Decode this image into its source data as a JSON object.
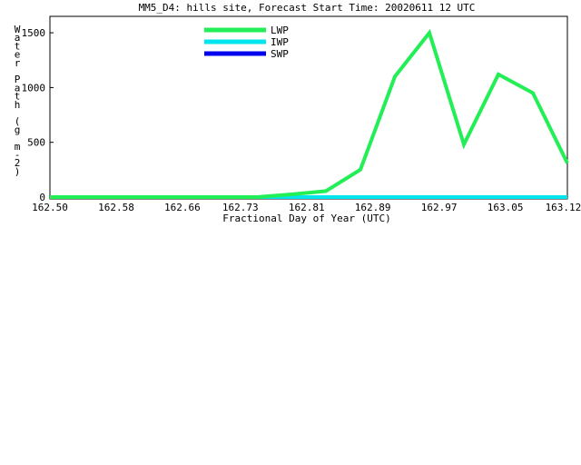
{
  "chart_data": {
    "type": "line",
    "title": "MM5_D4: hills site,  Forecast Start Time: 20020611 12 UTC",
    "xlabel": "Fractional Day of Year (UTC)",
    "ylabel": "Water Path (g m-2)",
    "ylabel_chars": [
      "W",
      "a",
      "t",
      "e",
      "r",
      "",
      "P",
      "a",
      "t",
      "h",
      "",
      "(",
      "g",
      "",
      "m",
      "-",
      "2",
      ")"
    ],
    "xlim": [
      162.5,
      163.125
    ],
    "ylim": [
      0,
      1650
    ],
    "x_ticks": [
      162.5,
      162.58,
      162.66,
      162.73,
      162.81,
      162.89,
      162.97,
      163.05,
      163.12
    ],
    "x_tick_labels": [
      "162.50",
      "162.58",
      "162.66",
      "162.73",
      "162.81",
      "162.89",
      "162.97",
      "163.05",
      "163.12"
    ],
    "y_ticks": [
      0,
      500,
      1000,
      1500
    ],
    "y_tick_labels": [
      "0",
      "500",
      "1000",
      "1500"
    ],
    "grid": false,
    "legend_position": "top-center",
    "series": [
      {
        "name": "LWP",
        "color": "#22ee55",
        "x": [
          162.5,
          162.5417,
          162.5833,
          162.625,
          162.6667,
          162.7083,
          162.75,
          162.7917,
          162.8333,
          162.875,
          162.9167,
          162.9583,
          163.0,
          163.0417,
          163.0833,
          163.125
        ],
        "values": [
          0,
          0,
          0,
          0,
          0,
          0,
          0,
          25,
          55,
          250,
          1100,
          1500,
          480,
          1120,
          950,
          310
        ]
      },
      {
        "name": "IWP",
        "color": "#00e5ee",
        "x": [
          162.5,
          163.125
        ],
        "values": [
          0,
          0
        ]
      },
      {
        "name": "SWP",
        "color": "#0000ee",
        "x": [
          162.5,
          163.125
        ],
        "values": [
          0,
          0
        ]
      }
    ]
  }
}
